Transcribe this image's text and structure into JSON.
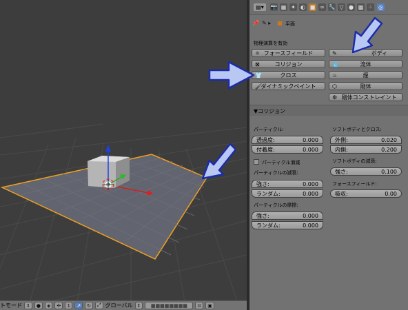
{
  "viewport": {
    "header": {
      "mode_label": "トモード",
      "orientation_label": "グローバル"
    }
  },
  "properties": {
    "breadcrumb": {
      "object_name": "平面"
    },
    "physics_label": "物理演算を有効",
    "buttons": {
      "force_field": "フォースフィールド",
      "collision": "コリジョン",
      "cloth": "クロス",
      "dynamic_paint": "ダイナミックペイント",
      "soft_body": "ボディ",
      "fluid": "流体",
      "smoke": "煙",
      "rigid_body": "剛体",
      "rigid_body_constraint": "剛体コンストレイント"
    },
    "collision_panel": {
      "title": "▼コリジョン",
      "particle_label": "パーティクル:",
      "permeability": {
        "label": "透過度:",
        "value": "0.000"
      },
      "stickiness": {
        "label": "付着度:",
        "value": "0.000"
      },
      "kill_particles": "パーティクル消滅",
      "particle_damping_label": "パーティクルの減衰:",
      "damping_strength": {
        "label": "強さ:",
        "value": "0.000"
      },
      "damping_random": {
        "label": "ランダム:",
        "value": "0.000"
      },
      "particle_friction_label": "パーティクルの摩擦:",
      "friction_strength": {
        "label": "強さ:",
        "value": "0.000"
      },
      "friction_random": {
        "label": "ランダム:",
        "value": "0.000"
      },
      "softbody_cloth_label": "ソフトボディとクロス:",
      "outer": {
        "label": "外側:",
        "value": "0.020"
      },
      "inner": {
        "label": "内側:",
        "value": "0.200"
      },
      "softbody_damping_label": "ソフトボディの減衰:",
      "sb_strength": {
        "label": "強さ:",
        "value": "0.100"
      },
      "force_field_label": "フォースフィールド:",
      "absorption": {
        "label": "吸収:",
        "value": "0.00"
      }
    }
  }
}
